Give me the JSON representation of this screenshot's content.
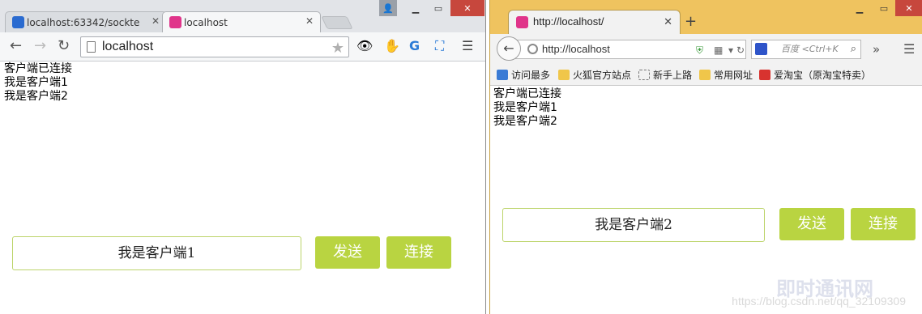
{
  "left_window": {
    "tabs": [
      {
        "title": "localhost:63342/socktes",
        "active": false
      },
      {
        "title": "localhost",
        "active": true
      }
    ],
    "address": "localhost",
    "messages": [
      "客户端已连接",
      "我是客户端1",
      "我是客户端2"
    ],
    "input_value": "我是客户端1",
    "send_label": "发送",
    "connect_label": "连接"
  },
  "right_window": {
    "tab_title": "http://localhost/",
    "address": "http://localhost",
    "search_placeholder": "百度 <Ctrl+K",
    "bookmarks": [
      "访问最多",
      "火狐官方站点",
      "新手上路",
      "常用网址",
      "爱淘宝（原淘宝特卖）"
    ],
    "messages": [
      "客户端已连接",
      "我是客户端1",
      "我是客户端2"
    ],
    "input_value": "我是客户端2",
    "send_label": "发送",
    "connect_label": "连接"
  },
  "watermark": {
    "text": "https://blog.csdn.net/qq_32109309",
    "logo": "即时通讯网"
  },
  "colors": {
    "button_green": "#b9d441",
    "input_border": "#bcd46a",
    "firefox_title": "#efc35f",
    "chrome_title": "#e2e4e8"
  }
}
